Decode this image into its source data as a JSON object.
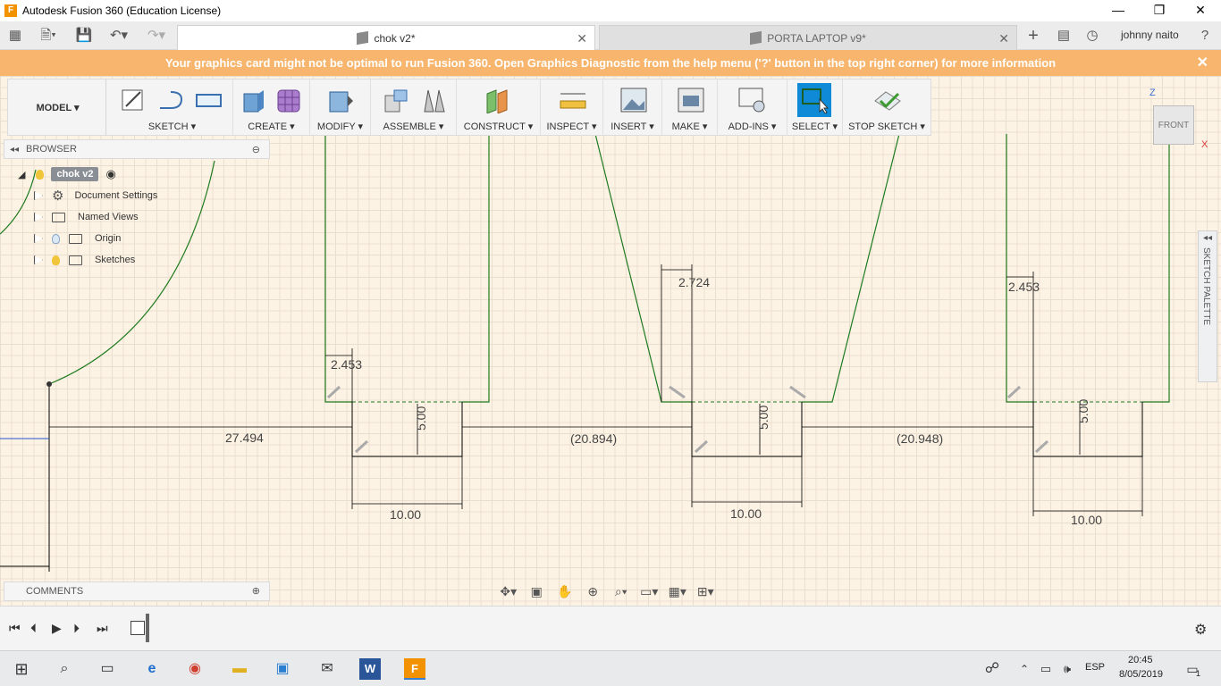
{
  "window": {
    "title": "Autodesk Fusion 360 (Education License)",
    "app_icon": "F",
    "controls": [
      "—",
      "❐",
      "✕"
    ]
  },
  "tabs": [
    {
      "label": "chok v2*",
      "active": true
    },
    {
      "label": "PORTA LAPTOP v9*",
      "active": false
    }
  ],
  "user": {
    "name": "johnny naito"
  },
  "notification": {
    "text": "Your graphics card might not be optimal to run Fusion 360. Open Graphics Diagnostic from the help menu ('?' button in the top right corner) for more information",
    "close": "✕"
  },
  "workspace": {
    "label": "MODEL ▾"
  },
  "toolbar": {
    "groups": [
      {
        "label": "SKETCH ▾"
      },
      {
        "label": "CREATE ▾"
      },
      {
        "label": "MODIFY ▾"
      },
      {
        "label": "ASSEMBLE ▾"
      },
      {
        "label": "CONSTRUCT ▾"
      },
      {
        "label": "INSPECT ▾"
      },
      {
        "label": "INSERT ▾"
      },
      {
        "label": "MAKE ▾"
      },
      {
        "label": "ADD-INS ▾"
      },
      {
        "label": "SELECT ▾"
      },
      {
        "label": "STOP SKETCH ▾"
      }
    ]
  },
  "browser": {
    "title": "BROWSER",
    "root": "chok v2",
    "items": [
      {
        "label": "Document Settings",
        "icon": "gear-icon"
      },
      {
        "label": "Named Views",
        "icon": "folder-icon"
      },
      {
        "label": "Origin",
        "icon": "folder-icon"
      },
      {
        "label": "Sketches",
        "icon": "folder-icon"
      }
    ]
  },
  "comments": {
    "title": "COMMENTS"
  },
  "viewcube": {
    "face": "FRONT",
    "axis_z": "Z",
    "axis_x": "X"
  },
  "sketch_palette": {
    "label": "SKETCH PALETTE"
  },
  "dimensions": {
    "d1": "2.453",
    "d2": "2.724",
    "d3": "2.453",
    "d4": "27.494",
    "d5": "(20.894)",
    "d6": "(20.948)",
    "d7": "5.00",
    "d8": "5.00",
    "d9": "5.00",
    "d10": "10.00",
    "d11": "10.00",
    "d12": "10.00"
  },
  "taskbar": {
    "language": "ESP",
    "time": "20:45",
    "date": "8/05/2019",
    "notifications": "1"
  },
  "colors": {
    "sketch_line": "#1f7a1f",
    "notification_bg": "#f7b56d",
    "canvas_bg": "#fdf3e4",
    "select_active": "#0f8ad6"
  }
}
